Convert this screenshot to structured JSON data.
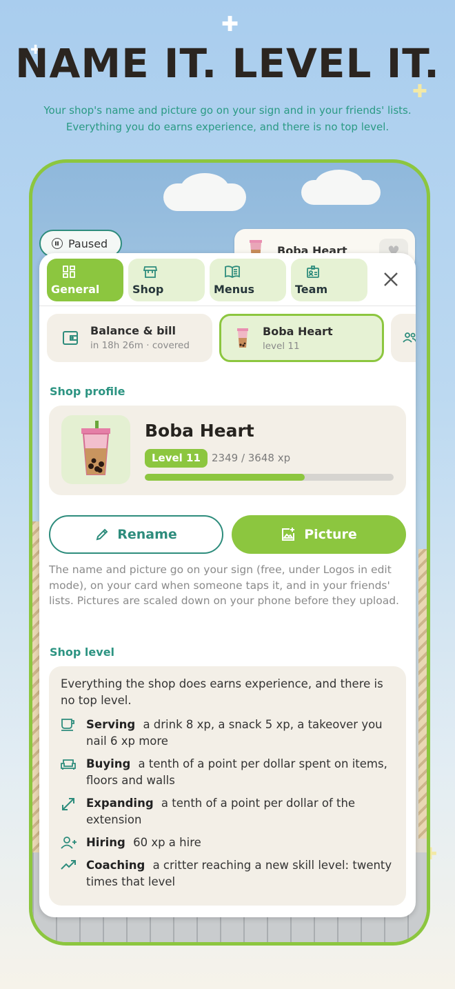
{
  "headline": "NAME IT. LEVEL IT.",
  "subline_1": "Your shop's name and picture go on your sign and in your friends' lists.",
  "subline_2": "Everything you do earns experience, and there is no top level.",
  "scene": {
    "paused_label": "Paused",
    "peek_title": "Boba Heart"
  },
  "tabs": [
    {
      "label": "General",
      "icon": "dashboard-icon",
      "active": true
    },
    {
      "label": "Shop",
      "icon": "storefront-icon",
      "active": false
    },
    {
      "label": "Menus",
      "icon": "menu-book-icon",
      "active": false
    },
    {
      "label": "Team",
      "icon": "badge-icon",
      "active": false
    }
  ],
  "chips": [
    {
      "title": "Balance & bill",
      "subtitle": "in 18h 26m · covered",
      "icon": "wallet-icon"
    },
    {
      "title": "Boba Heart",
      "subtitle": "level 11",
      "icon": "boba-icon",
      "selected": true
    }
  ],
  "profile": {
    "section_label": "Shop profile",
    "name": "Boba Heart",
    "level_label": "Level 11",
    "xp_text": "2349 / 3648 xp",
    "xp_progress": 0.644
  },
  "actions": {
    "rename_label": "Rename",
    "picture_label": "Picture"
  },
  "help_text": "The name and picture go on your sign (free, under Logos in edit mode), on your card when someone taps it, and in your friends' lists. Pictures are scaled down on your phone before they upload.",
  "level": {
    "section_label": "Shop level",
    "intro": "Everything the shop does earns experience, and there is no top level.",
    "rules": [
      {
        "name": "Serving",
        "desc": "a drink 8 xp, a snack 5 xp, a takeover you nail 6 xp more",
        "icon": "coffee-cup-icon"
      },
      {
        "name": "Buying",
        "desc": "a tenth of a point per dollar spent on items, floors and walls",
        "icon": "sofa-icon"
      },
      {
        "name": "Expanding",
        "desc": "a tenth of a point per dollar of the extension",
        "icon": "expand-arrows-icon"
      },
      {
        "name": "Hiring",
        "desc": "60 xp a hire",
        "icon": "person-add-icon"
      },
      {
        "name": "Coaching",
        "desc": "a critter reaching a new skill level: twenty times that level",
        "icon": "trending-up-icon"
      }
    ]
  },
  "colors": {
    "accent_green": "#8cc63f",
    "teal": "#2d8c7c",
    "card_bg": "#f3efe7"
  }
}
